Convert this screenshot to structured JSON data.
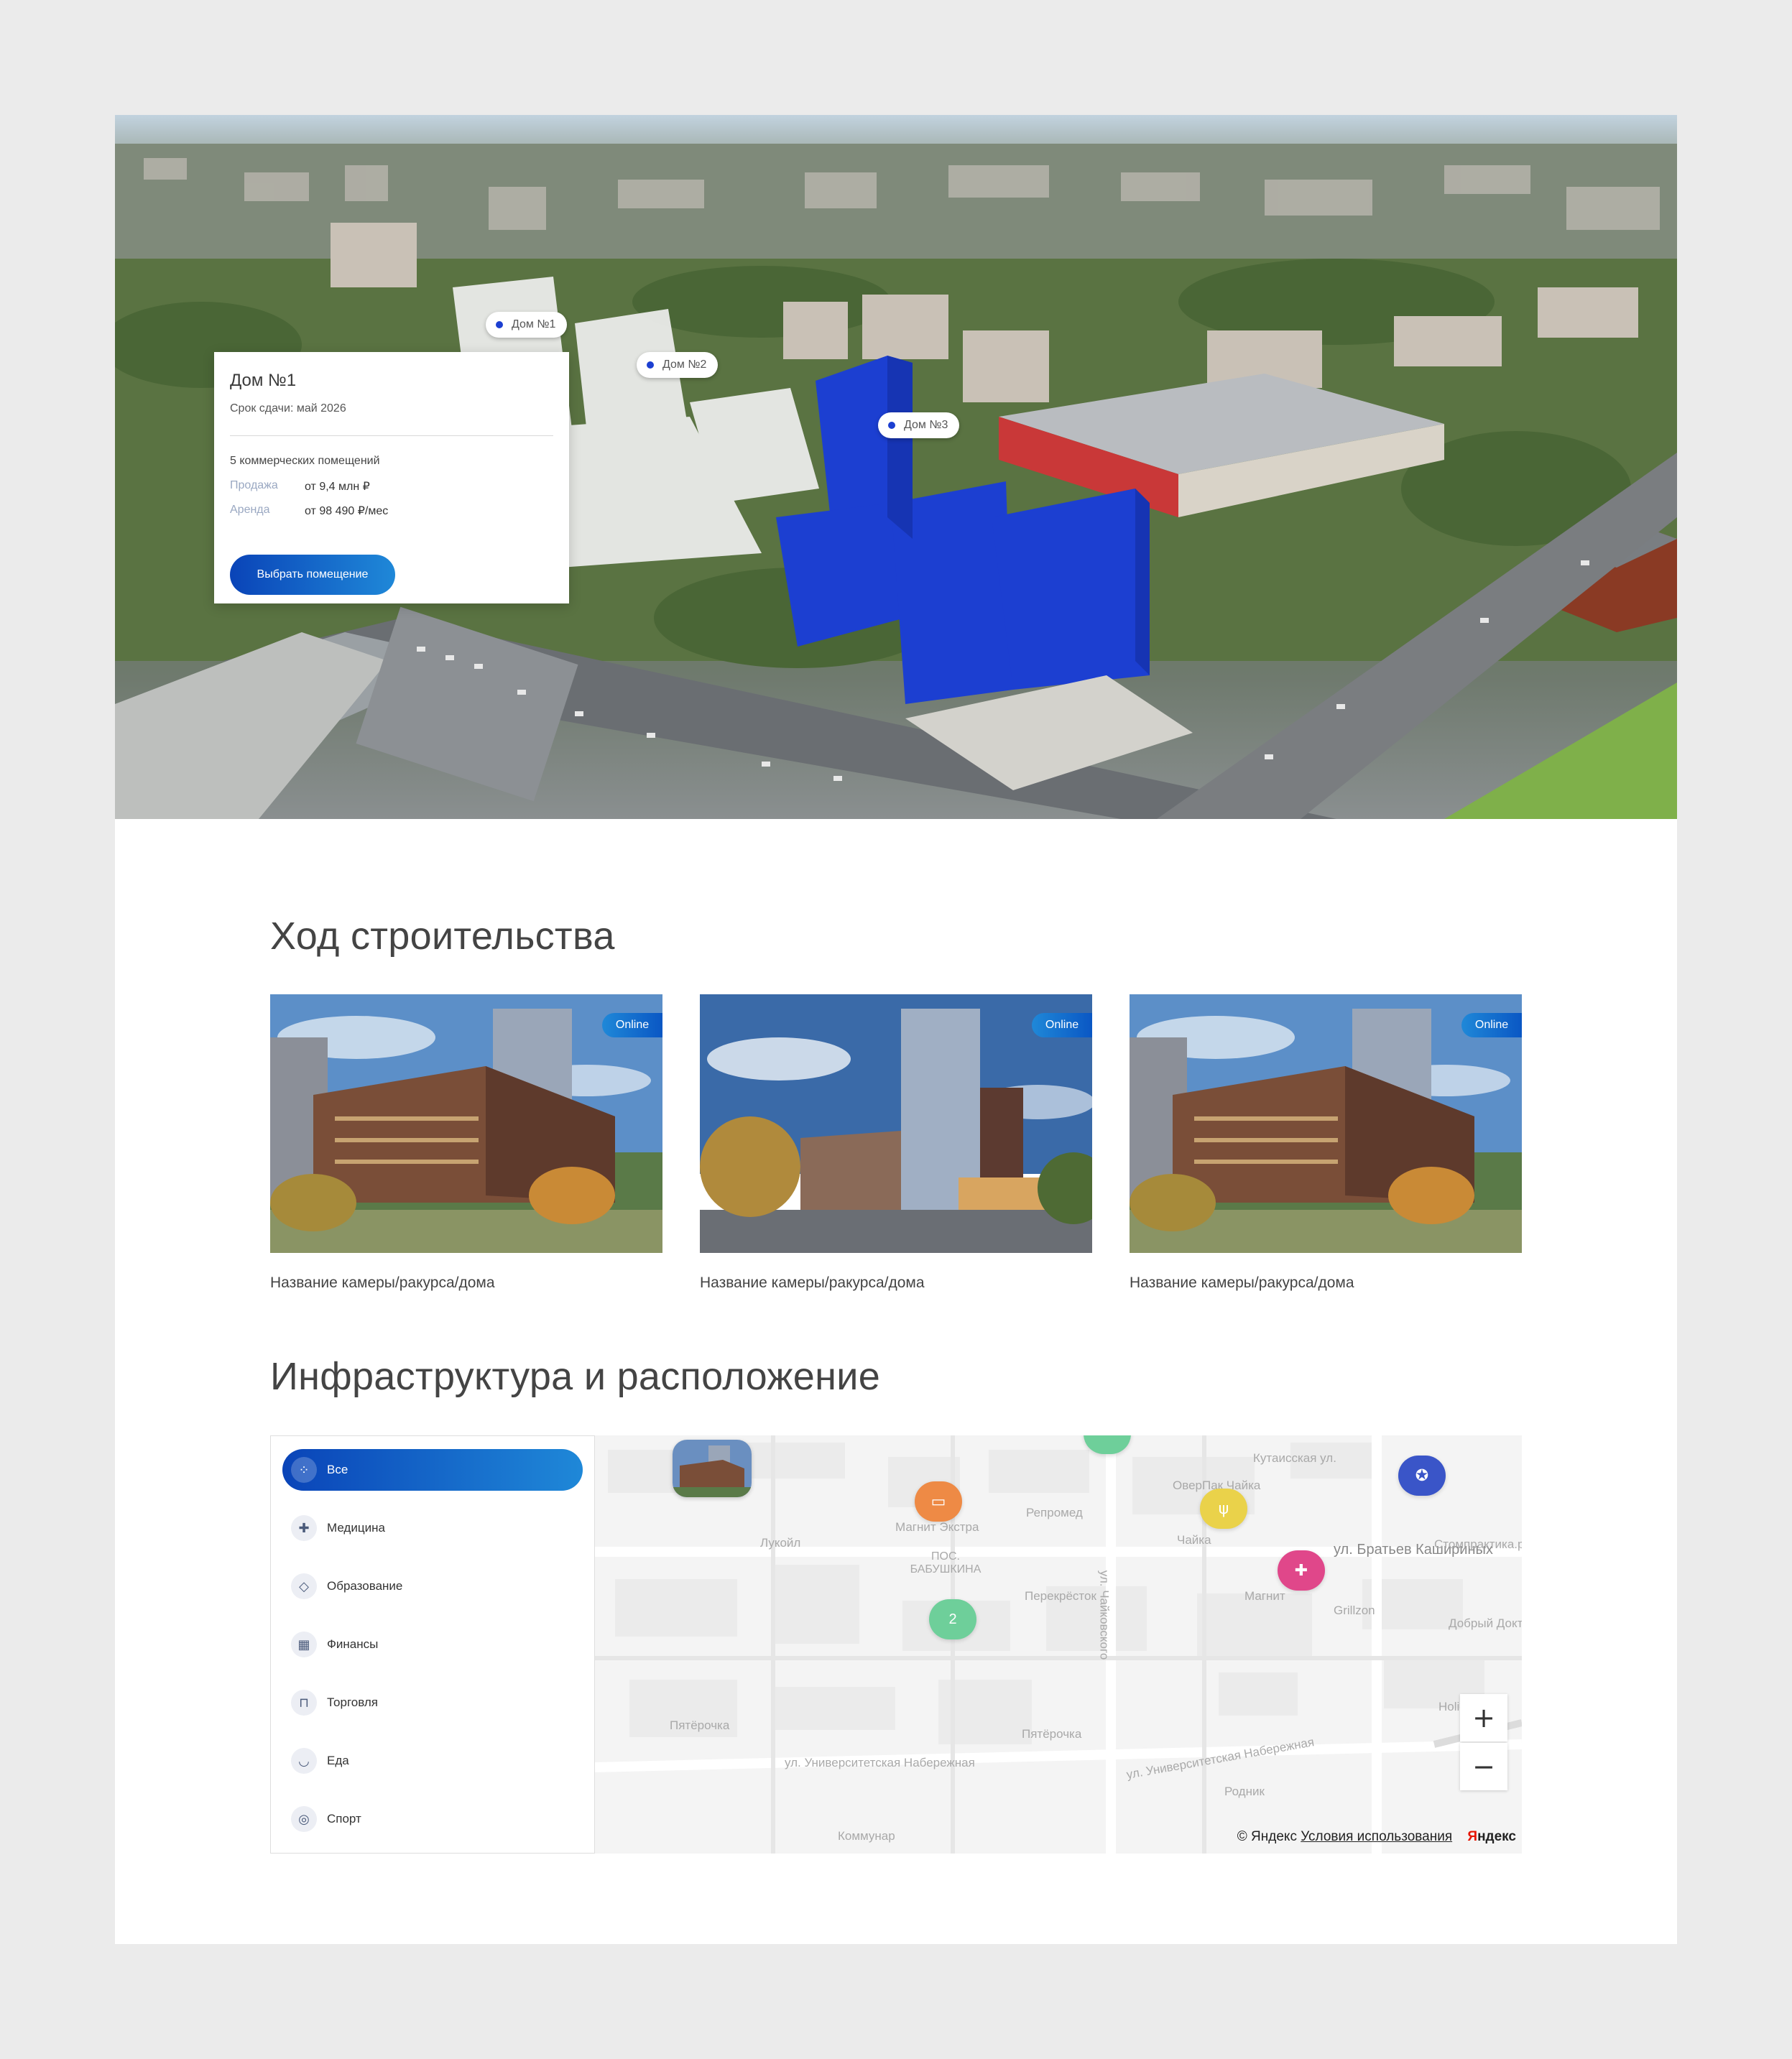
{
  "hero": {
    "pins": [
      {
        "label": "Дом №1"
      },
      {
        "label": "Дом №2"
      },
      {
        "label": "Дом №3"
      }
    ],
    "card": {
      "title": "Дом №1",
      "deadline": "Срок сдачи: май 2026",
      "premises": "5 коммерческих помещений",
      "sale_key": "Продажа",
      "sale_value": "от 9,4 млн ₽",
      "rent_key": "Аренда",
      "rent_value": "от 98 490 ₽/мес",
      "button": "Выбрать помещение"
    }
  },
  "construction": {
    "title": "Ход строительства",
    "cameras": [
      {
        "badge": "Online",
        "caption": "Название камеры/ракурса/дома"
      },
      {
        "badge": "Online",
        "caption": "Название камеры/ракурса/дома"
      },
      {
        "badge": "Online",
        "caption": "Название камеры/ракурса/дома"
      }
    ]
  },
  "infra": {
    "title": "Инфраструктура и расположение",
    "categories": [
      {
        "label": "Все",
        "icon": "grid-icon"
      },
      {
        "label": "Медицина",
        "icon": "medkit-icon"
      },
      {
        "label": "Образование",
        "icon": "graduation-cap-icon"
      },
      {
        "label": "Финансы",
        "icon": "bank-icon"
      },
      {
        "label": "Торговля",
        "icon": "cart-icon"
      },
      {
        "label": "Еда",
        "icon": "bowl-icon"
      },
      {
        "label": "Спорт",
        "icon": "ball-icon"
      }
    ],
    "map": {
      "cluster_count": "2",
      "labels": {
        "street1": "Кутаисская ул.",
        "street2": "ул. Братьев Кашириных",
        "street3": "ул. Университетская Набережная",
        "street4": "ул. Университетская Набережная",
        "street5": "ул. Чайковского",
        "poi1": "Лукойл",
        "poi2": "Магнит Экстра",
        "poi3": "Репромед",
        "poi4": "ОверПак Чайка",
        "poi5": "Чайка",
        "poi6": "Перекрёсток",
        "poi7": "Магнит",
        "poi8": "Grillzon",
        "poi9": "Добрый Доктор",
        "poi10": "Стомпрактика.рф",
        "poi11": "Holiday Inn",
        "poi12": "Пятёрочка",
        "poi13": "Пятёрочка",
        "poi14": "Родник",
        "poi15": "Коммунар",
        "district": "ПОС. БАБУШКИНА"
      },
      "zoom_in": "+",
      "zoom_out": "−",
      "copyright": "© Яндекс",
      "terms": "Условия использования",
      "logo": "Яндекс"
    }
  },
  "colors": {
    "accent": "#0a44b8",
    "accent_light": "#1f88d8",
    "building_highlight": "#1c3fd1",
    "marker_orange": "#ee8a45",
    "marker_yellow": "#ead24a",
    "marker_blue": "#3a55c8",
    "marker_pink": "#e0478a",
    "marker_green": "#6ecf9a"
  }
}
